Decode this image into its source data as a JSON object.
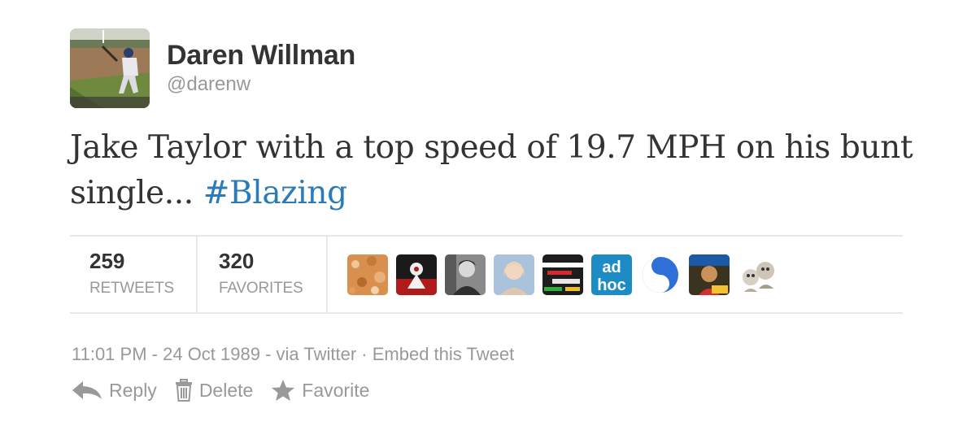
{
  "user": {
    "name": "Daren Willman",
    "handle": "@darenw"
  },
  "tweet": {
    "text": "Jake Taylor with a top speed of 19.7 MPH on his bunt single... ",
    "hashtag": "#Blazing"
  },
  "stats": {
    "retweets_count": "259",
    "retweets_label": "RETWEETS",
    "favorites_count": "320",
    "favorites_label": "FAVORITES"
  },
  "favoriter_avatars": [
    {
      "name": "avatar-1",
      "color": "#d9904e"
    },
    {
      "name": "avatar-2",
      "color": "#b11a1a"
    },
    {
      "name": "avatar-3",
      "color": "#5a5a5a"
    },
    {
      "name": "avatar-4",
      "color": "#aac2dc"
    },
    {
      "name": "avatar-5",
      "color": "#1d1d1d"
    },
    {
      "name": "avatar-6",
      "color": "#1e8cc4",
      "text": "ad hoc"
    },
    {
      "name": "avatar-7",
      "color": "#2f6fd8"
    },
    {
      "name": "avatar-8",
      "color": "#6a5535"
    },
    {
      "name": "avatar-9",
      "color": "#d8d0c4"
    }
  ],
  "meta": {
    "time": "11:01 PM",
    "date": "24 Oct 1989",
    "via": "via Twitter",
    "embed_link": "Embed this Tweet"
  },
  "actions": {
    "reply_label": "Reply",
    "delete_label": "Delete",
    "favorite_label": "Favorite"
  },
  "colors": {
    "hashtag": "#2b7bb9",
    "muted_text": "#999999",
    "primary_text": "#333333",
    "divider": "#e8e8e8"
  },
  "icons": {
    "reply": "reply-icon",
    "delete": "trash-icon",
    "favorite": "star-icon"
  }
}
